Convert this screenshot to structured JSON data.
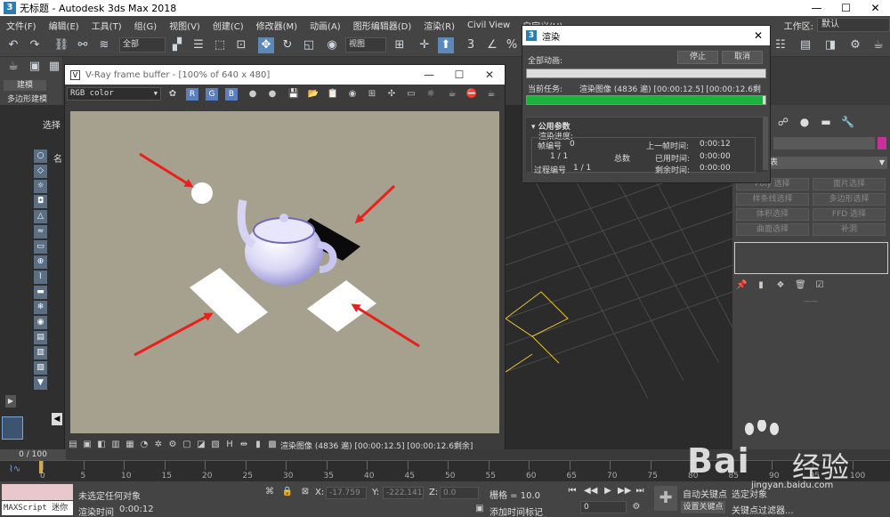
{
  "window": {
    "title": "无标题 - Autodesk 3ds Max 2018",
    "logo": "3",
    "minimize": "—",
    "maximize": "☐",
    "close": "✕"
  },
  "menu": {
    "items": [
      "文件(F)",
      "编辑(E)",
      "工具(T)",
      "组(G)",
      "视图(V)",
      "创建(C)",
      "修改器(M)",
      "动画(A)",
      "图形编辑器(D)",
      "渲染(R)",
      "Civil View",
      "自定义(U)"
    ],
    "workspace_label": "工作区:",
    "workspace_value": "默认"
  },
  "toolbar": {
    "filter_select": "全部",
    "view_select": "视图"
  },
  "ribbon": {
    "tab": "建模",
    "sub": "多边形建模"
  },
  "left_panel": {
    "select_label": "选择",
    "name_label": "名"
  },
  "vfb": {
    "logo": "V",
    "title": "V-Ray frame buffer - [100% of 640 x 480]",
    "channel": "RGB color",
    "status": "渲染图像 (4836 遍) [00:00:12.5] [00:00:12.6剩余]"
  },
  "render_dialog": {
    "logo": "3",
    "title": "渲染",
    "total_anim_label": "全部动画:",
    "stop_button": "停止",
    "cancel_button": "取消",
    "current_task_label": "当前任务:",
    "current_task_value": "渲染图像 (4836 遍) [00:00:12.5] [00:00:12.6剩",
    "progress_total": 0,
    "progress_current": 0.99,
    "section_title": "公用参数",
    "render_progress_label": "渲染进度:",
    "frame_no_label": "帧编号",
    "frame_no_value": "0",
    "last_frame_time_label": "上一帧时间:",
    "last_frame_time_value": "0:00:12",
    "frame_count": "1 / 1",
    "total_label": "总数",
    "elapsed_label": "已用时间:",
    "elapsed_value": "0:00:00",
    "passes_label": "过程编号",
    "passes_value": "1 / 1",
    "remaining_label": "剩余时间:",
    "remaining_value": "0:00:00"
  },
  "cmd_panel": {
    "dropdown": "表",
    "buttons": [
      "Poly 选择",
      "面片选择",
      "样条线选择",
      "多边形选择",
      "体积选择",
      "FFD 选择",
      "曲面选择",
      "补洞"
    ],
    "separator": "——"
  },
  "timeline": {
    "slider": "0 / 100",
    "ticks": [
      "0",
      "5",
      "10",
      "15",
      "20",
      "25",
      "30",
      "35",
      "40",
      "45",
      "50",
      "55",
      "60",
      "65",
      "70",
      "75",
      "80",
      "85",
      "90",
      "95",
      "100"
    ]
  },
  "status": {
    "maxscript": "MAXScript 迷你",
    "no_selection": "未选定任何对象",
    "render_time_label": "渲染时间",
    "render_time_value": "0:00:12",
    "x_label": "X:",
    "x_value": "-17.759",
    "y_label": "Y:",
    "y_value": "-222.141",
    "z_label": "Z:",
    "z_value": "0.0",
    "grid_label": "栅格 = 10.0",
    "add_time_tag": "添加时间标记",
    "auto_key": "自动关键点",
    "selected_obj": "选定对象",
    "set_key": "设置关键点",
    "key_filters": "关键点过滤器...",
    "frame_value": "0"
  },
  "watermark": {
    "text": "Bai",
    "cn": "经验",
    "url": "jingyan.baidu.com"
  },
  "colors": {
    "accent": "#5b88b9",
    "progress_green": "#1db240",
    "render_bg": "#a6a08f",
    "arrow_red": "#e8211d"
  }
}
